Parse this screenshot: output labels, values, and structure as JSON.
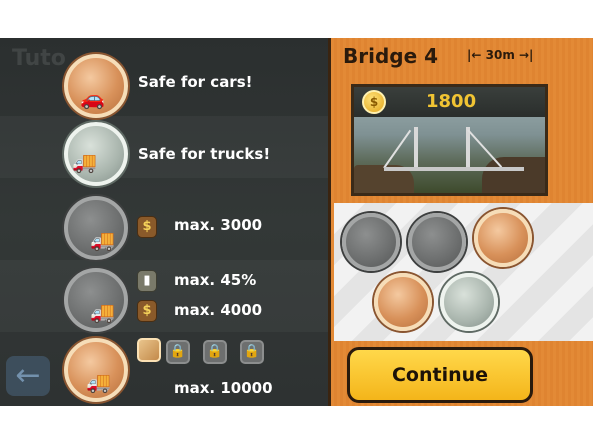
{
  "left_panel": {
    "ghost_title": "Tuto",
    "rows": [
      {
        "medal": "gold",
        "vehicle": "car",
        "text": "Safe for cars!"
      },
      {
        "medal": "silver",
        "vehicle": "truck",
        "text": "Safe for trucks!"
      },
      {
        "medal": "grey",
        "vehicle": "truck",
        "icon": "money-bag-icon",
        "text": "max. 3000"
      },
      {
        "medal": "grey",
        "vehicle": "truck",
        "icon1": "stress-meter-icon",
        "text1": "max. 45%",
        "icon2": "money-bag-icon",
        "text2": "max. 4000"
      },
      {
        "medal": "gold",
        "vehicle": "truck",
        "materials": [
          "wood",
          "locked",
          "locked",
          "locked"
        ],
        "text": "max. 10000"
      }
    ]
  },
  "right_panel": {
    "title": "Bridge 4",
    "span": "|← 30m →|",
    "score": "1800",
    "continue_label": "Continue"
  },
  "colors": {
    "panel_dark": "#2f3333",
    "panel_orange": "#e38a36",
    "gold_text": "#f1c433",
    "button_yellow": "#f4b51a"
  }
}
